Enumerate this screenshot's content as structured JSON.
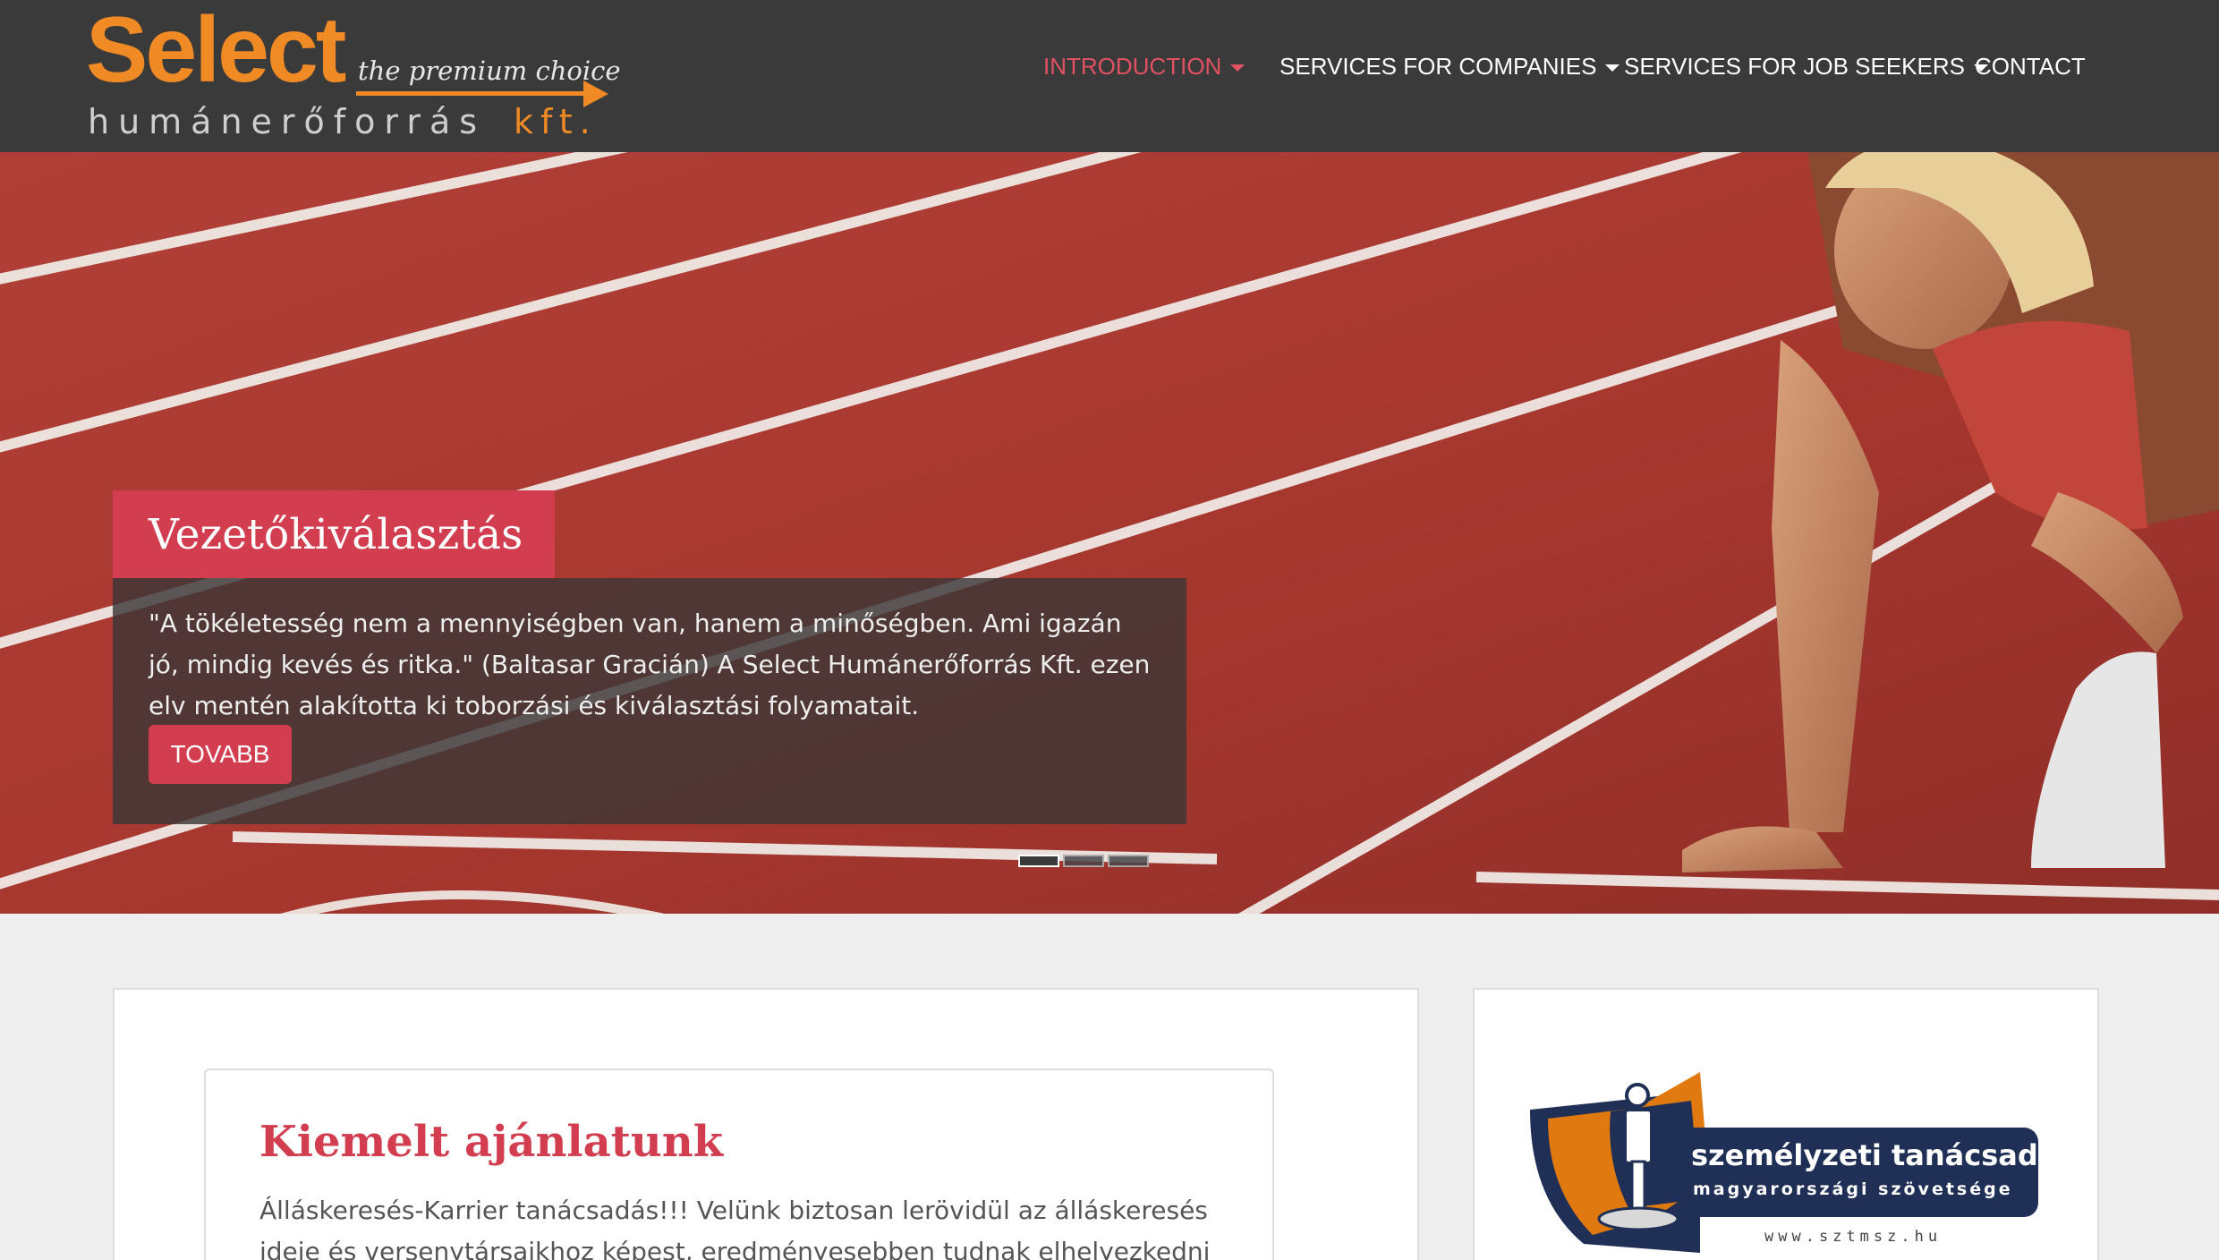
{
  "logo": {
    "brand": "Select",
    "tagline": "the premium choice",
    "subtitle": "humánerőforrás",
    "suffix": "kft.",
    "accent_color": "#f08a24"
  },
  "nav": {
    "items": [
      {
        "label": "INTRODUCTION",
        "has_dropdown": true,
        "active": true
      },
      {
        "label": "SERVICES FOR COMPANIES",
        "has_dropdown": true,
        "active": false
      },
      {
        "label": "SERVICES FOR JOB SEEKERS",
        "has_dropdown": true,
        "active": false
      },
      {
        "label": "CONTACT",
        "has_dropdown": false,
        "active": false
      }
    ],
    "active_color": "#e05262"
  },
  "hero": {
    "title": "Vezetőkiválasztás",
    "body": "\"A tökéletesség nem a mennyiségben van, hanem a minőségben. Ami igazán jó, mindig kevés és ritka.\" (Baltasar Gracián) A Select Humánerőforrás Kft. ezen elv mentén alakította ki toborzási és kiválasztási folyamatait.",
    "button_label": "TOVABB",
    "slides_count": 3,
    "active_slide": 1,
    "accent_color": "#d23e4f"
  },
  "featured": {
    "title": "Kiemelt ajánlatunk",
    "text": "Álláskeresés-Karrier tanácsadás!!! Velünk biztosan lerövidül az álláskeresés ideje és versenytársaikhoz képest, eredményesebben tudnak elhelyezkedni a"
  },
  "sidebar": {
    "badge_line1": "személyzeti tanácsadók",
    "badge_line2": "magyarországi szövetsége",
    "badge_url": "www.sztmsz.hu"
  }
}
